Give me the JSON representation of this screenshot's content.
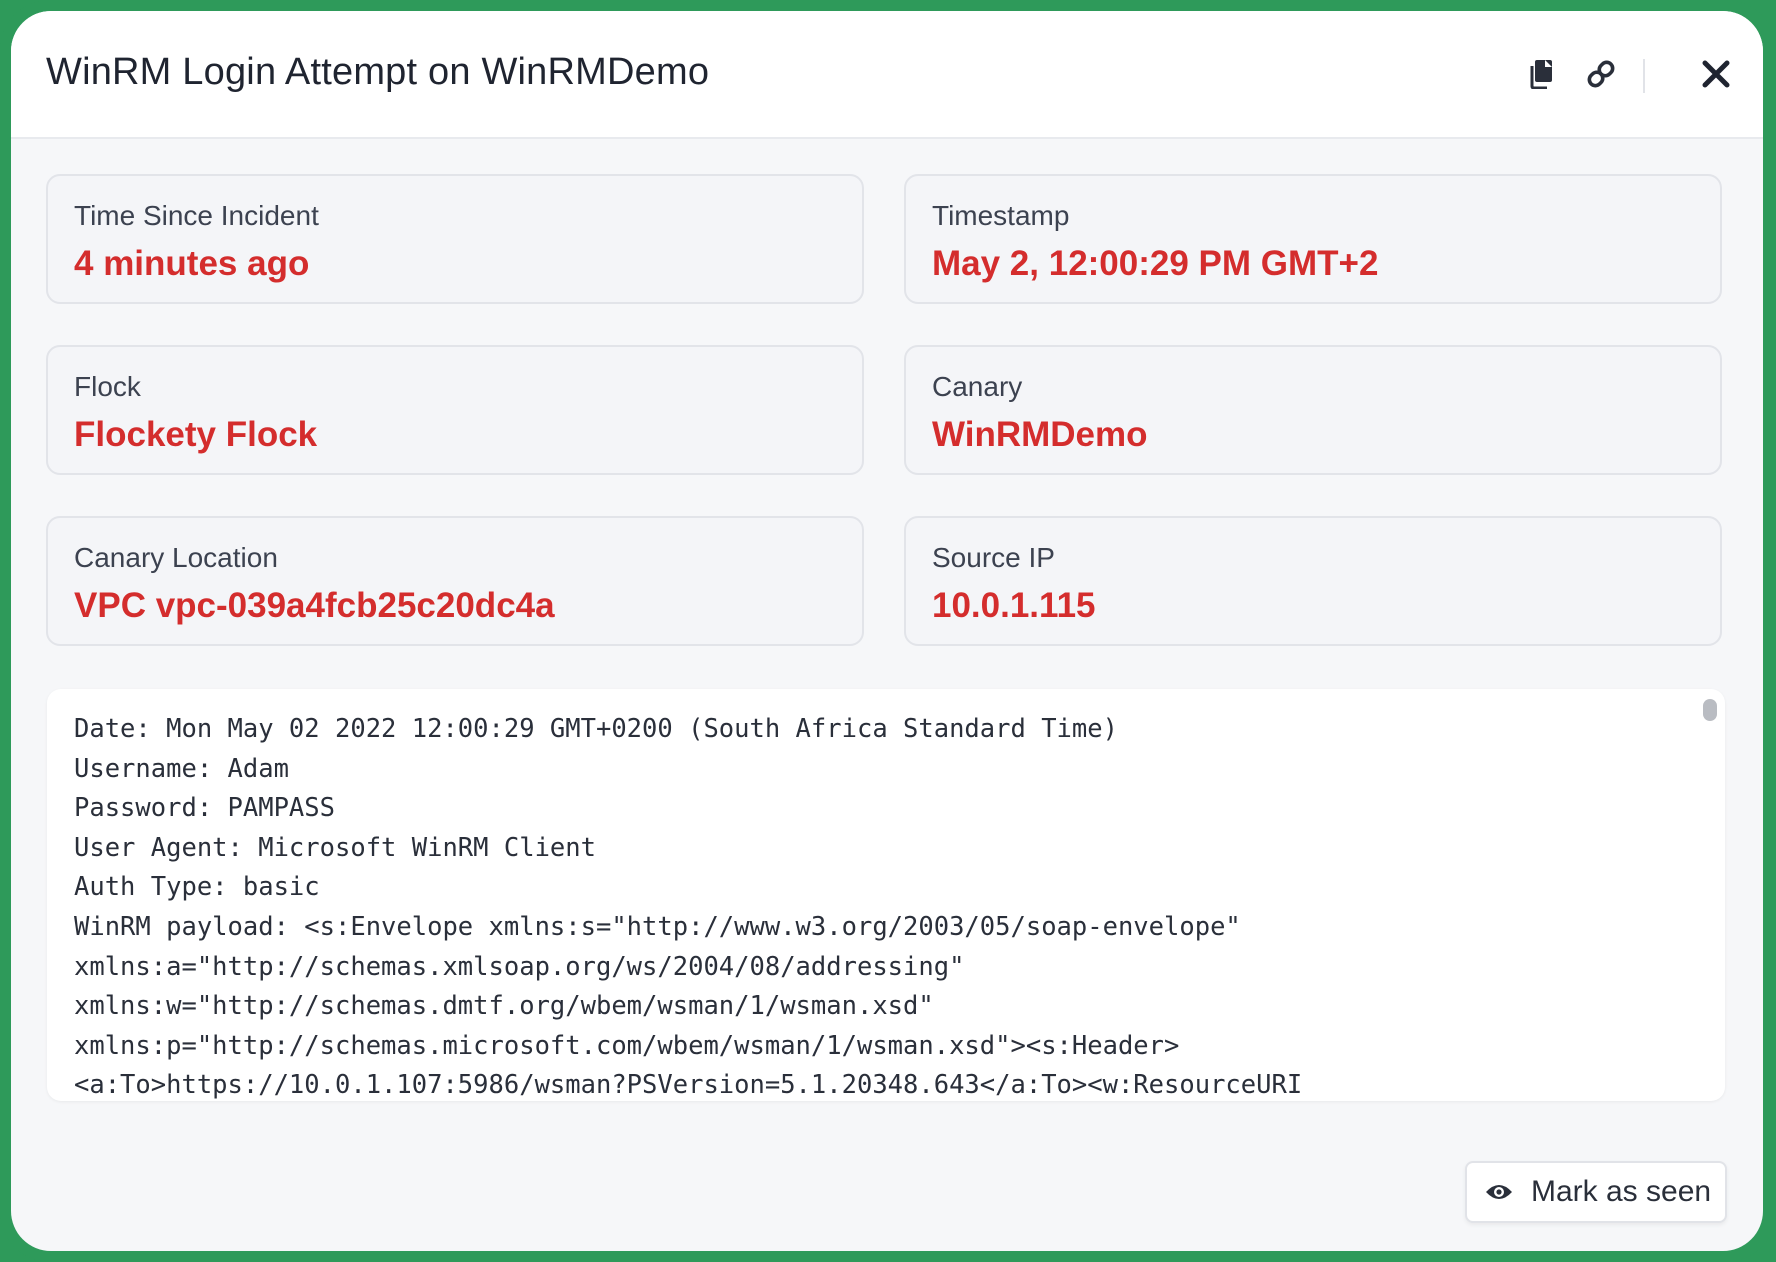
{
  "header": {
    "title": "WinRM Login Attempt on WinRMDemo",
    "icons": [
      "copy-icon",
      "link-icon",
      "close-icon"
    ]
  },
  "cards": [
    {
      "label": "Time Since Incident",
      "value": "4 minutes ago"
    },
    {
      "label": "Timestamp",
      "value": "May 2, 12:00:29 PM GMT+2"
    },
    {
      "label": "Flock",
      "value": "Flockety Flock"
    },
    {
      "label": "Canary",
      "value": "WinRMDemo"
    },
    {
      "label": "Canary Location",
      "value": "VPC vpc-039a4fcb25c20dc4a"
    },
    {
      "label": "Source IP",
      "value": "10.0.1.115"
    }
  ],
  "log": {
    "lines": [
      "Date: Mon May 02 2022 12:00:29 GMT+0200 (South Africa Standard Time)",
      "Username: Adam",
      "Password: PAMPASS",
      "User Agent: Microsoft WinRM Client",
      "Auth Type: basic",
      "WinRM payload: <s:Envelope xmlns:s=\"http://www.w3.org/2003/05/soap-envelope\"",
      "xmlns:a=\"http://schemas.xmlsoap.org/ws/2004/08/addressing\"",
      "xmlns:w=\"http://schemas.dmtf.org/wbem/wsman/1/wsman.xsd\"",
      "xmlns:p=\"http://schemas.microsoft.com/wbem/wsman/1/wsman.xsd\"><s:Header>",
      "<a:To>https://10.0.1.107:5986/wsman?PSVersion=5.1.20348.643</a:To><w:ResourceURI"
    ]
  },
  "footer": {
    "mark_seen_label": "Mark as seen"
  },
  "colors": {
    "accent_value": "#d42d2d",
    "frame_green": "#2e9a5a"
  }
}
